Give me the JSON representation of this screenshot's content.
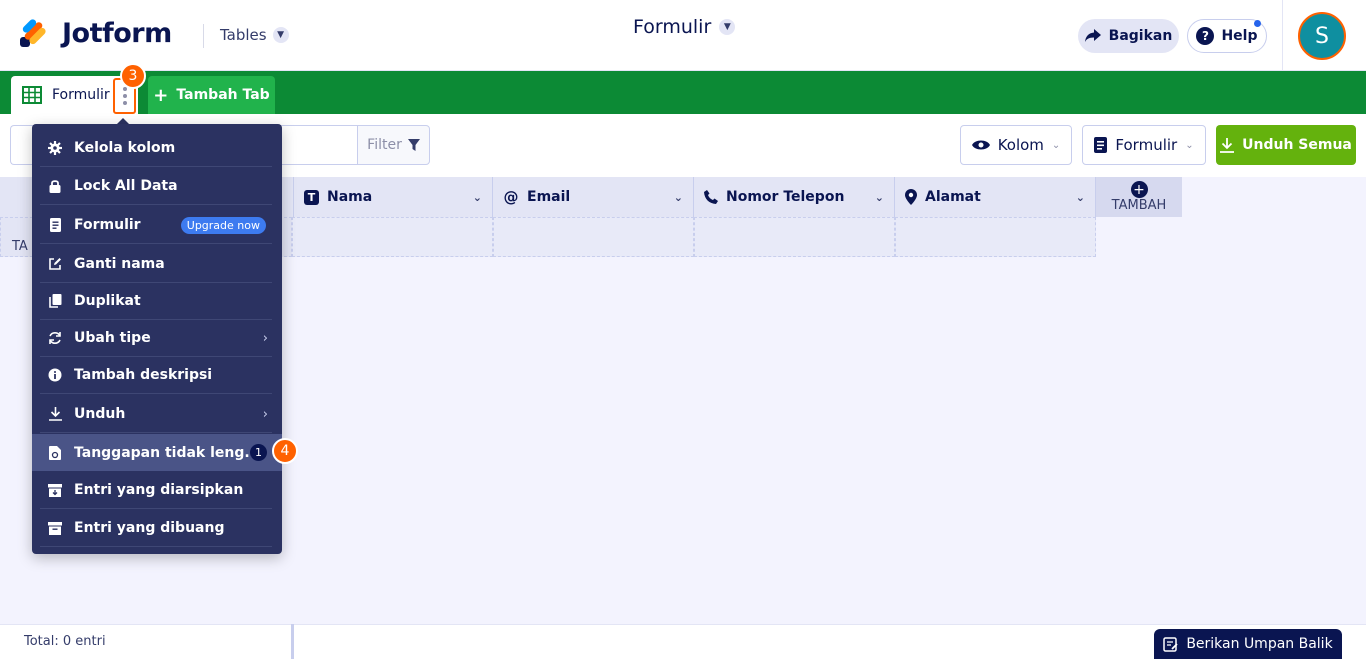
{
  "header": {
    "brand": "Jotform",
    "app_switcher": "Tables",
    "title": "Formulir",
    "share_label": "Bagikan",
    "help_label": "Help",
    "avatar_letter": "S",
    "colors": {
      "accent": "#ff6100",
      "avatar_bg": "#0f8fa0"
    }
  },
  "tabs": {
    "active_label": "Formulir",
    "step_badge": "3",
    "add_tab_label": "Tambah Tab",
    "colors": {
      "bar": "#0c8a35",
      "add_tab": "#21b34c"
    }
  },
  "toolbar": {
    "search_placeholder": "",
    "filter_label": "Filter",
    "columns_label": "Kolom",
    "form_label": "Formulir",
    "download_all_label": "Unduh Semua"
  },
  "grid": {
    "columns": [
      {
        "label": "Nama",
        "icon": "text-icon"
      },
      {
        "label": "Email",
        "icon": "at-icon"
      },
      {
        "label": "Nomor Telepon",
        "icon": "phone-icon"
      },
      {
        "label": "Alamat",
        "icon": "location-pin-icon"
      }
    ],
    "add_column_label": "TAMBAH",
    "row_add_label": "TA"
  },
  "menu": {
    "items": [
      {
        "label": "Kelola kolom",
        "icon": "gear-icon"
      },
      {
        "label": "Lock All Data",
        "icon": "lock-icon"
      },
      {
        "label": "Formulir",
        "icon": "form-icon",
        "badge": "Upgrade now"
      },
      {
        "label": "Ganti nama",
        "icon": "edit-icon"
      },
      {
        "label": "Duplikat",
        "icon": "duplicate-icon"
      },
      {
        "label": "Ubah tipe",
        "icon": "refresh-icon",
        "submenu": true
      },
      {
        "label": "Tambah deskripsi",
        "icon": "info-icon"
      },
      {
        "label": "Unduh",
        "icon": "download-icon",
        "submenu": true
      },
      {
        "label": "Tanggapan tidak leng...",
        "icon": "incomplete-doc-icon",
        "count": "1",
        "highlighted": true
      },
      {
        "label": "Entri yang diarsipkan",
        "icon": "archive-icon"
      },
      {
        "label": "Entri yang dibuang",
        "icon": "trash-icon"
      }
    ],
    "step_badge": "4"
  },
  "footer": {
    "total_label": "Total: 0 entri",
    "feedback_label": "Berikan Umpan Balik"
  }
}
